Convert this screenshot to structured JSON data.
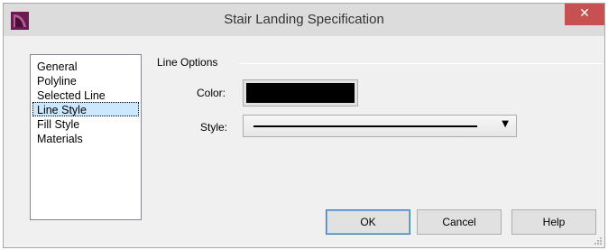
{
  "window": {
    "title": "Stair Landing Specification",
    "close_label": "✕"
  },
  "sidebar": {
    "items": [
      {
        "label": "General",
        "selected": false
      },
      {
        "label": "Polyline",
        "selected": false
      },
      {
        "label": "Selected Line",
        "selected": false
      },
      {
        "label": "Line Style",
        "selected": true
      },
      {
        "label": "Fill Style",
        "selected": false
      },
      {
        "label": "Materials",
        "selected": false
      }
    ]
  },
  "line_options": {
    "group_label": "Line Options",
    "color_label": "Color:",
    "color_value": "#000000",
    "style_label": "Style:",
    "style_value": "solid"
  },
  "buttons": {
    "ok": "OK",
    "cancel": "Cancel",
    "help": "Help"
  },
  "colors": {
    "close_button": "#c75050",
    "selection": "#cce8ff",
    "app_icon": "#7a1f5c"
  }
}
